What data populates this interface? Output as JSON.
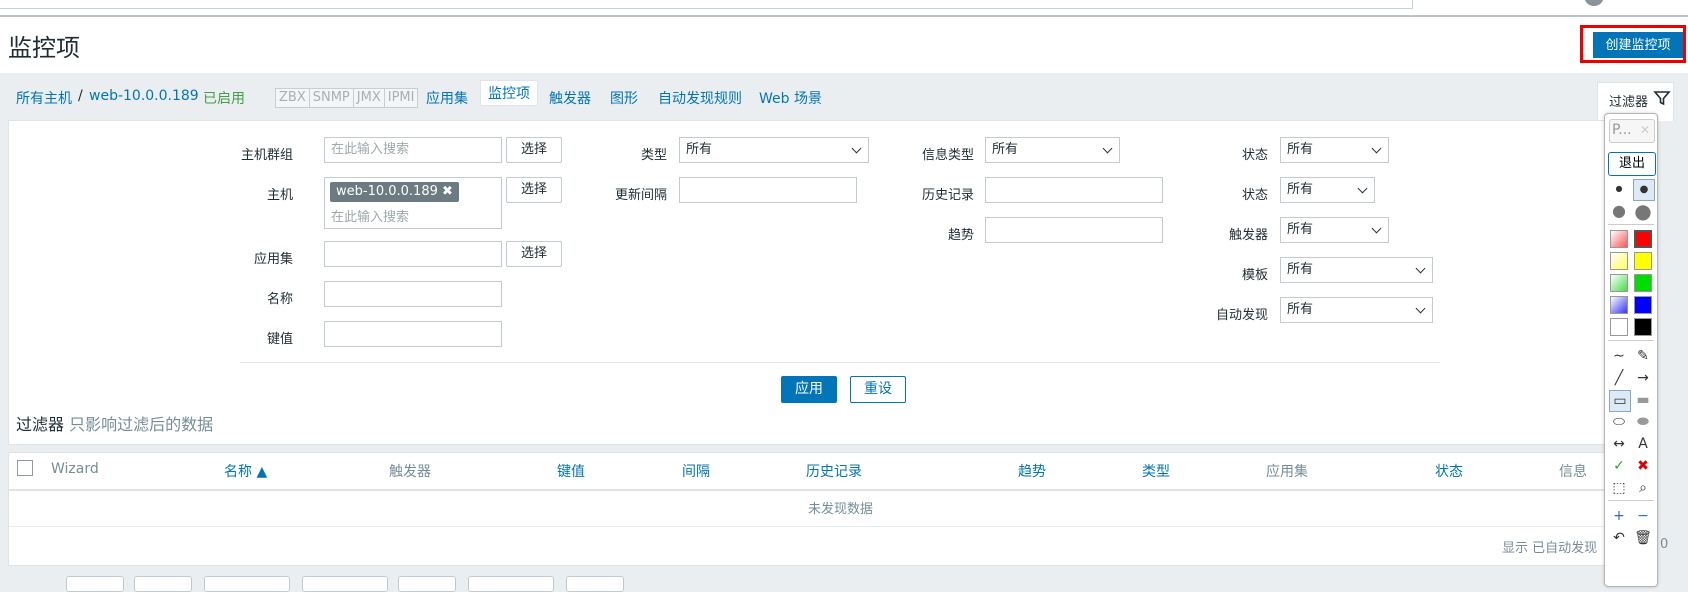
{
  "page": {
    "title": "监控项",
    "create_button": "创建监控项"
  },
  "breadcrumb": {
    "all_hosts": "所有主机",
    "separator": "/",
    "host": "web-10.0.0.189",
    "enabled": "已启用"
  },
  "availability_tags": [
    "ZBX",
    "SNMP",
    "JMX",
    "IPMI"
  ],
  "host_tabs": [
    "应用集",
    "监控项",
    "触发器",
    "图形",
    "自动发现规则",
    "Web 场景"
  ],
  "filter_tab": {
    "label": "过滤器"
  },
  "filter": {
    "host_group": {
      "label": "主机群组",
      "placeholder": "在此输入搜索",
      "select": "选择"
    },
    "host": {
      "label": "主机",
      "chip": "web-10.0.0.189",
      "placeholder": "在此输入搜索",
      "select": "选择"
    },
    "application": {
      "label": "应用集",
      "value": "",
      "select": "选择"
    },
    "name": {
      "label": "名称",
      "value": ""
    },
    "key": {
      "label": "键值",
      "value": ""
    },
    "type": {
      "label": "类型",
      "value": "所有"
    },
    "update_interval": {
      "label": "更新间隔",
      "value": ""
    },
    "info_type": {
      "label": "信息类型",
      "value": "所有"
    },
    "history": {
      "label": "历史记录",
      "value": ""
    },
    "trends": {
      "label": "趋势",
      "value": ""
    },
    "state": {
      "label": "状态",
      "value": "所有"
    },
    "status": {
      "label": "状态",
      "value": "所有"
    },
    "triggers": {
      "label": "触发器",
      "value": "所有"
    },
    "template": {
      "label": "模板",
      "value": "所有"
    },
    "discovery": {
      "label": "自动发现",
      "value": "所有"
    },
    "apply": "应用",
    "reset": "重设",
    "note_label": "过滤器",
    "note_text": "只影响过滤后的数据"
  },
  "table": {
    "columns": [
      "Wizard",
      "名称 ▲",
      "触发器",
      "键值",
      "间隔",
      "历史记录",
      "趋势",
      "类型",
      "应用集",
      "状态",
      "信息"
    ],
    "empty": "未发现数据",
    "footer": "显示 已自动发现",
    "footer_tail": "0"
  },
  "draw_toolbar": {
    "top_label": "P...",
    "exit": "退出",
    "colors": [
      "#ff0000",
      "#ffff00",
      "#00dd00",
      "#0000ff",
      "#000000"
    ]
  }
}
